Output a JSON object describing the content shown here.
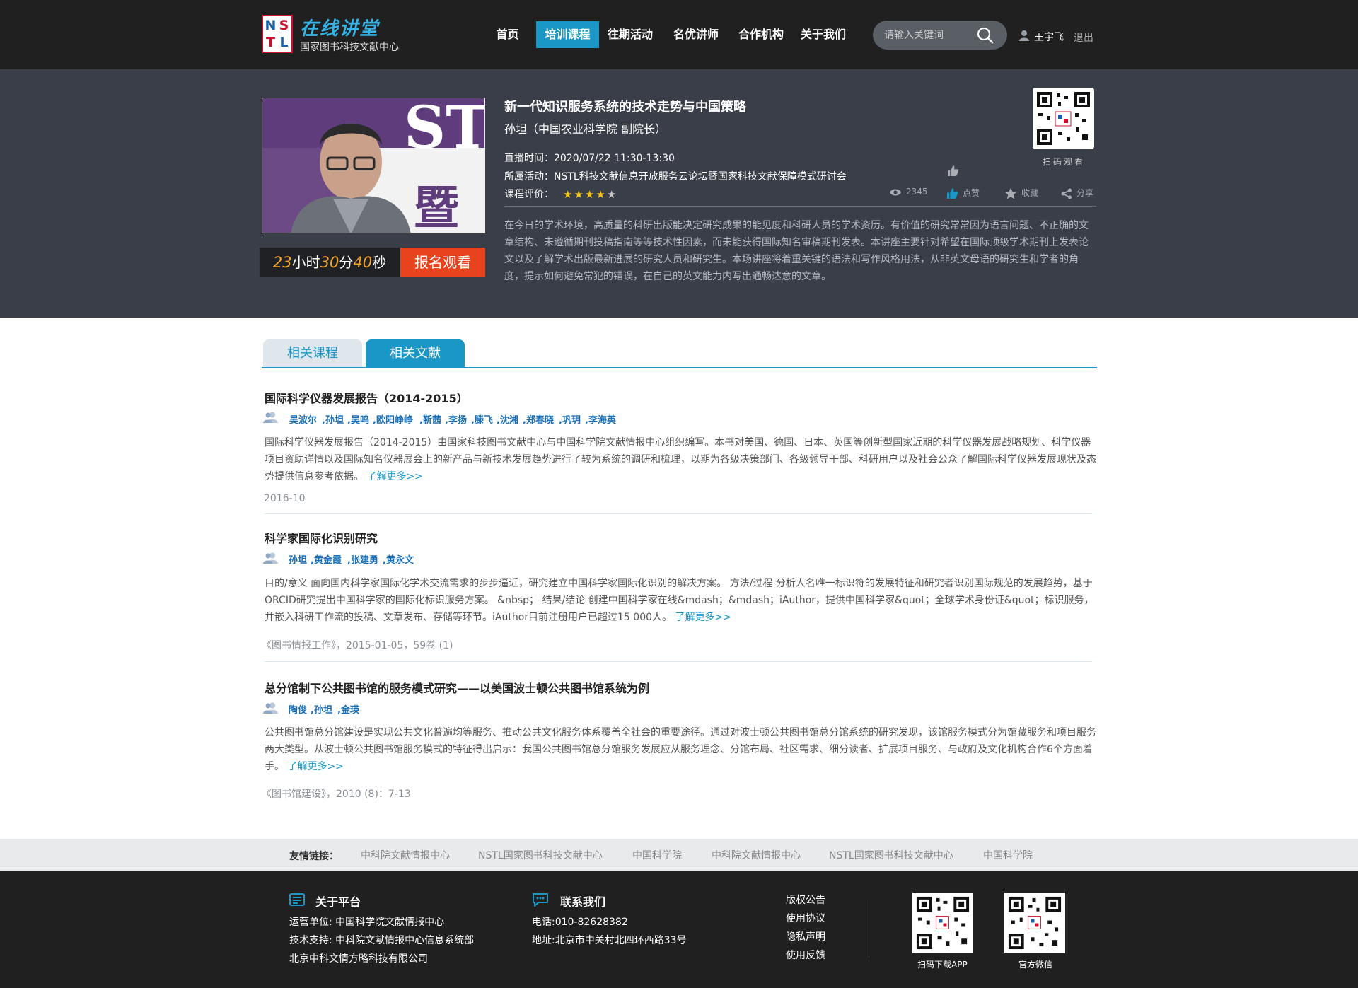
{
  "header": {
    "logo_letters": [
      "N",
      "S",
      "T",
      "L"
    ],
    "logo_title": "在线讲堂",
    "logo_subtitle": "国家图书科技文献中心",
    "nav": [
      {
        "label": "首页"
      },
      {
        "label": "培训课程"
      },
      {
        "label": "往期活动"
      },
      {
        "label": "名优讲师"
      },
      {
        "label": "合作机构"
      },
      {
        "label": "关于我们"
      }
    ],
    "active_nav": "培训课程",
    "search_placeholder": "请输入关键词",
    "user_name": "王宇飞",
    "logout_label": "退出"
  },
  "course": {
    "title": "新一代知识服务系统的技术走势与中国策略",
    "lecturer": "孙坦（中国农业科学院  副院长）",
    "live_time_label": "直播时间：",
    "live_time": "2020/07/22  11:30-13:30",
    "activity_label": "所属活动：",
    "activity": "NSTL科技文献信息开放服务云论坛暨国家科技文献保障模式研讨会",
    "rating_label": "课程评价：",
    "rating": 4,
    "rating_max": 5,
    "countdown": {
      "hours": "23",
      "h_unit": "小时",
      "minutes": "30",
      "m_unit": "分",
      "seconds": "40",
      "s_unit": "秒"
    },
    "signup_label": "报名观看",
    "qr_label": "扫码观看",
    "stats": {
      "views": "2345",
      "like_label": "点赞",
      "favorite_label": "收藏",
      "share_label": "分享"
    },
    "description": "在今日的学术环境，高质量的科研出版能决定研究成果的能见度和科研人员的学术资历。有价值的研究常常因为语言问题、不正确的文章结构、未遵循期刊投稿指南等等技术性因素，而未能获得国际知名审稿期刊发表。本讲座主要针对希望在国际顶级学术期刊上发表论文以及了解学术出版最新进展的研究人员和研究生。本场讲座将着重关键的语法和写作风格用法，从非英文母语的研究生和学者的角度，提示如何避免常犯的错误，在自己的英文能力内写出通畅达意的文章。"
  },
  "tabs": [
    {
      "label": "相关课程"
    },
    {
      "label": "相关文献"
    }
  ],
  "active_tab": "相关文献",
  "literature": [
    {
      "title": "国际科学仪器发展报告（2014-2015）",
      "authors": [
        "吴波尔",
        ",孙坦",
        ",吴鸣",
        ",欧阳峥峥",
        ",靳茜",
        ",李扬",
        ",滕飞",
        ",沈湘",
        ",郑春晓",
        ",巩玥",
        ",李海英"
      ],
      "abstract": "国际科学仪器发展报告（2014-2015）由国家科技图书文献中心与中国科学院文献情报中心组织编写。本书对美国、德国、日本、英国等创新型国家近期的科学仪器发展战略规划、科学仪器项目资助详情以及国际知名仪器展会上的新产品与新技术发展趋势进行了较为系统的调研和梳理，以期为各级决策部门、各级领导干部、科研用户以及社会公众了解国际科学仪器发展现状及态势提供信息参考依据。",
      "more": "了解更多>>",
      "source": "2016-10"
    },
    {
      "title": "科学家国际化识别研究",
      "authors": [
        "孙坦",
        ",黄金霞",
        ",张建勇",
        ",黄永文"
      ],
      "abstract": "目的/意义 面向国内科学家国际化学术交流需求的步步逼近，研究建立中国科学家国际化识别的解决方案。 方法/过程 分析人名唯一标识符的发展特征和研究者识别国际规范的发展趋势，基于ORCID研究提出中国科学家的国际化标识服务方案。 &nbsp； 结果/结论 创建中国科学家在线&mdash；&mdash；iAuthor，提供中国科学家&quot；全球学术身份证&quot；标识服务，并嵌入科研工作流的投稿、文章发布、存储等环节。iAuthor目前注册用户已超过15 000人。",
      "more": "了解更多>>",
      "source": "《图书情报工作》，2015-01-05，59卷 (1)"
    },
    {
      "title": "总分馆制下公共图书馆的服务模式研究——以美国波士顿公共图书馆系统为例",
      "authors": [
        "陶俊",
        ",孙坦",
        ",金瑛"
      ],
      "abstract": "公共图书馆总分馆建设是实现公共文化普遍均等服务、推动公共文化服务体系覆盖全社会的重要途径。通过对波士顿公共图书馆总分馆系统的研究发现，该馆服务模式分为馆藏服务和项目服务两大类型。从波士顿公共图书馆服务模式的特征得出启示：我国公共图书馆总分馆服务发展应从服务理念、分馆布局、社区需求、细分读者、扩展项目服务、与政府及文化机构合作6个方面着手。",
      "more": "了解更多>>",
      "source": "《图书馆建设》，2010 (8)：7-13"
    }
  ],
  "friend_links": {
    "label": "友情链接：",
    "items": [
      "中科院文献情报中心",
      "NSTL国家图书科技文献中心",
      "中国科学院",
      "中科院文献情报中心",
      "NSTL国家图书科技文献中心",
      "中国科学院"
    ]
  },
  "footer": {
    "about": {
      "title": "关于平台",
      "lines": [
        "运营单位: 中国科学院文献情报中心",
        "技术支持: 中科院文献情报中心信息系统部",
        "北京中科文情方略科技有限公司"
      ]
    },
    "contact": {
      "title": "联系我们",
      "lines": [
        "电话:010-82628382",
        "地址:北京市中关村北四环西路33号"
      ]
    },
    "links": [
      "版权公告",
      "使用协议",
      "隐私声明",
      "使用反馈"
    ],
    "qr": [
      {
        "label": "扫码下载APP"
      },
      {
        "label": "官方微信"
      }
    ]
  },
  "colors": {
    "accent": "#1a97c7",
    "header_bg": "#202020",
    "banner_bg": "#393e48",
    "signup": "#e8431f",
    "countdown_digits": "#f0a62d"
  }
}
